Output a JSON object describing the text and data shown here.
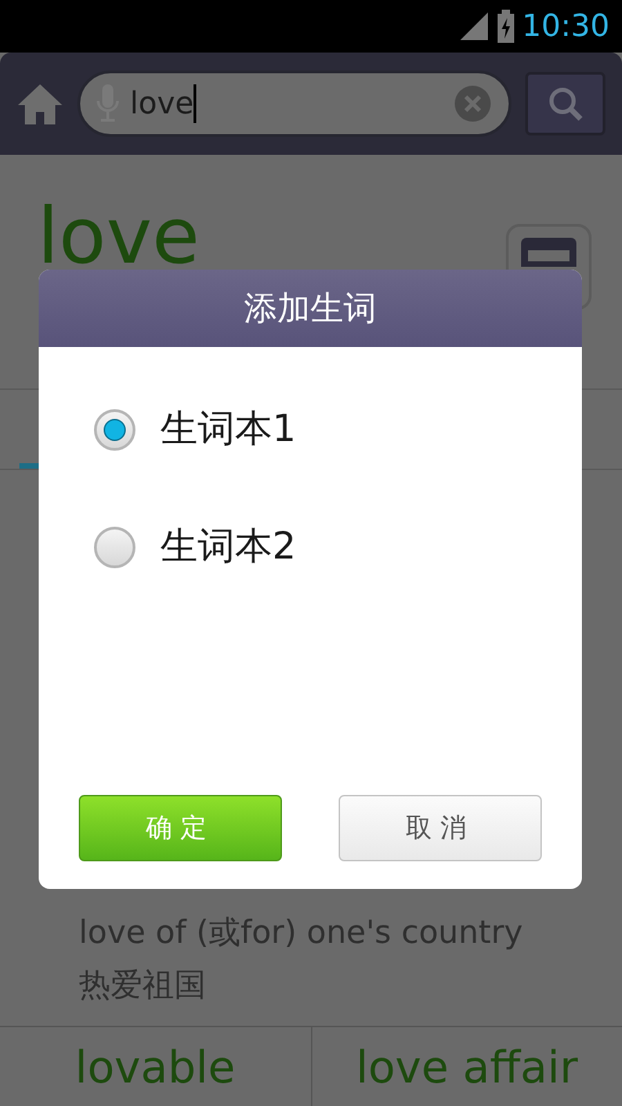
{
  "status_bar": {
    "time": "10:30"
  },
  "search": {
    "value": "love"
  },
  "entry": {
    "headword": "love"
  },
  "example_lines": [
    "love of (或for) one's country",
    "热爱祖国"
  ],
  "related_words": [
    "lovable",
    "love affair"
  ],
  "dialog": {
    "title": "添加生词",
    "options": [
      {
        "label": "生词本1",
        "selected": true
      },
      {
        "label": "生词本2",
        "selected": false
      }
    ],
    "buttons": [
      {
        "label": "确定",
        "kind": "primary"
      },
      {
        "label": "取消",
        "kind": "secondary"
      }
    ]
  }
}
